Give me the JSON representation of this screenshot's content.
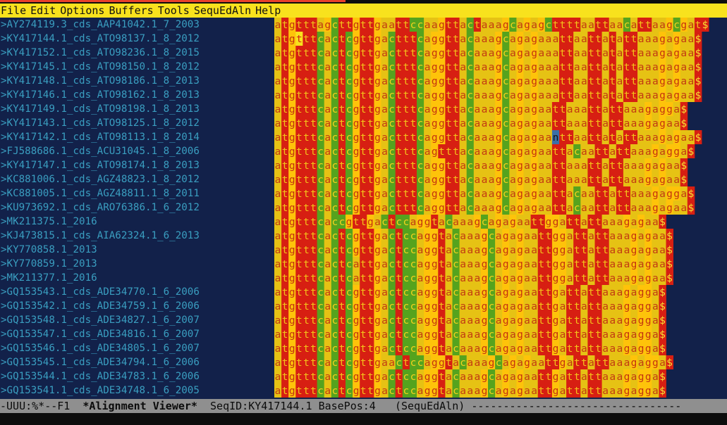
{
  "menu": [
    "File",
    "Edit",
    "Options",
    "Buffers",
    "Tools",
    "SequEdAln",
    "Help"
  ],
  "sequences": [
    {
      "name": ">AY274119.3_cds_AAP41042.1_7_2003",
      "seq": "atgtttagcttgttgaattccaagttactaaagcagagcttttaattaacattaagcgat$"
    },
    {
      "name": ">KY417144.1_cds_ATO98137.1_8_2012",
      "seq": "atgtttcactcgttgactttcaggttacaaagcagagaaattaattatattaaagagaa$"
    },
    {
      "name": ">KY417152.1_cds_ATO98236.1_8_2015",
      "seq": "atgtttcactcgttgactttcaggttacaaagcagagaaattaattatattaaagagaa$"
    },
    {
      "name": ">KY417145.1_cds_ATO98150.1_8_2012",
      "seq": "atgtttcactcgttgactttcaggttacaaagcagagaaattaattatattaaagagaa$"
    },
    {
      "name": ">KY417148.1_cds_ATO98186.1_8_2013",
      "seq": "atgtttcactcgttgactttcaggttacaaagcagagaaattaattatattaaagagaa$"
    },
    {
      "name": ">KY417146.1_cds_ATO98162.1_8_2013",
      "seq": "atgtttcactcgttgactttcaggttacaaagcagagaaattaattatattaaagagaa$"
    },
    {
      "name": ">KY417149.1_cds_ATO98198.1_8_2013",
      "seq": "atgtttcactcgttgactttcaggttacaaagcagagaattaaattattaaagagga$"
    },
    {
      "name": ">KY417143.1_cds_ATO98125.1_8_2012",
      "seq": "atgtttcactcgttgactttcaggttacaaagcagagaattaaattattaaagagaa$"
    },
    {
      "name": ">KY417142.1_cds_ATO98113.1_8_2014",
      "seq": "atgtttcactcgttgactttcaggttacaaagcagagaanttaattatattaaagagaa$"
    },
    {
      "name": ">FJ588686.1_cds_ACU31045.1_8_2006",
      "seq": "atgtttcactcgttgactttcagtttacaaagcagagaattacaattattaaagagga$"
    },
    {
      "name": ">KY417147.1_cds_ATO98174.1_8_2013",
      "seq": "atgtttcactcgttgactttcaggttacaaagcagagaattaaattattaaagagaa$"
    },
    {
      "name": ">KC881006.1_cds_AGZ48823.1_8_2012",
      "seq": "atgtttcactcgttgactttcaggttacaaagcagagaattaaattattaaagagaa$"
    },
    {
      "name": ">KC881005.1_cds_AGZ48811.1_8_2011",
      "seq": "atgtttcactcgttgactttcaggttacaaagcagagaattacaattattaaagagga$"
    },
    {
      "name": ">KU973692.1_cds_ARO76386.1_6_2012",
      "seq": "atgtttcactcgttgactttcaggttacaaagcagagaattacaattattaaagagaa$"
    },
    {
      "name": ">MK211375.1_2016",
      "seq": "atgtttcaccgttgactccaggtacaaagcagagaattggattattaaagagaa$"
    },
    {
      "name": ">KJ473815.1_cds_AIA62324.1_6_2013",
      "seq": "atgtttcactcgttgactccaggtacaaagcagagaattggattattaaagagaa$"
    },
    {
      "name": ">KY770858.1_2013",
      "seq": "atgtttcactcgttgactccaggtacaaagcagagaattggattattaaagagaa$"
    },
    {
      "name": ">KY770859.1_2013",
      "seq": "atgtttcactcattgactccaggtacaaagcagagaattggattattaaagagaa$"
    },
    {
      "name": ">MK211377.1_2016",
      "seq": "atgtttcactcattgactccaggtacaaagcagagaattggattattaaagagaa$"
    },
    {
      "name": ">GQ153543.1_cds_ADE34770.1_6_2006",
      "seq": "atgtttcactcgttgactccaggtacaaagcagagaattgattattaaagagga$"
    },
    {
      "name": ">GQ153542.1_cds_ADE34759.1_6_2006",
      "seq": "atgtttcactcgttgactccaggtacaaagcagagaattgattattaaagagga$"
    },
    {
      "name": ">GQ153548.1_cds_ADE34827.1_6_2007",
      "seq": "atgtttcactcgttgactccaggtacaaagcagagaattgattattaaagagga$"
    },
    {
      "name": ">GQ153547.1_cds_ADE34816.1_6_2007",
      "seq": "atgtttcactcgttgactccaggtacaaagcagagaattgattattaaagagga$"
    },
    {
      "name": ">GQ153546.1_cds_ADE34805.1_6_2007",
      "seq": "atgtttcactcgttgactccaggtacaaagcagagaattgattattaaagagga$"
    },
    {
      "name": ">GQ153545.1_cds_ADE34794.1_6_2006",
      "seq": "atgtttcactcgttgaactccaggtacaaagcagagaattgattattaaagagga$"
    },
    {
      "name": ">GQ153544.1_cds_ADE34783.1_6_2006",
      "seq": "atgtttcactcgttgactccaggtacaaagcagagaattgattattaaagagga$"
    },
    {
      "name": ">GQ153541.1_cds_ADE34748.1_6_2005",
      "seq": "atgtttcactcgttgactccaggtacaaagcagagaattgattattaaagagga$"
    }
  ],
  "base_colors": {
    "a": "#e6c214",
    "t": "#d71f12",
    "g": "#fec30a",
    "c": "#55a31e",
    "n": "#3b6fa8",
    "-": "#0a1f4d",
    "$": "#d71f12",
    "default": "#e6c214"
  },
  "letter_colors": {
    "a": "#c23a12",
    "t": "#f3c21b",
    "g": "#c33410",
    "c": "#f3d21e",
    "n": "#111111",
    "-": "#e8e8e8",
    "$": "#f7e033",
    "default": "#c33410"
  },
  "cursor": {
    "row": 1,
    "col": 3,
    "char": "t",
    "color": "#f8e21d"
  },
  "modeline": {
    "status": "-UUU:%*--F1",
    "buffer": "*Alignment Viewer*",
    "seqid": "SeqID:KY417144.1",
    "basepos": "BasePos:4",
    "mode": "(SequEdAln)",
    "dashes": "---------------------------------"
  }
}
